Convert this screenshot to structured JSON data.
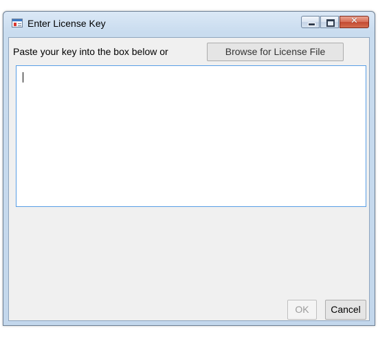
{
  "window": {
    "title": "Enter License Key",
    "icon": "license-key-app-icon",
    "caption_buttons": {
      "minimize": "minimize-icon",
      "maximize": "maximize-icon",
      "close": "close-icon",
      "close_glyph": "✕"
    }
  },
  "dialog": {
    "prompt": "Paste your key into the box below or",
    "browse_label": "Browse for License File",
    "key_text": "",
    "ok_label": "OK",
    "ok_enabled": false,
    "cancel_label": "Cancel"
  },
  "colors": {
    "focus_border": "#569de5",
    "close_button": "#c34a33",
    "window_frame": "#c3d7ec"
  }
}
